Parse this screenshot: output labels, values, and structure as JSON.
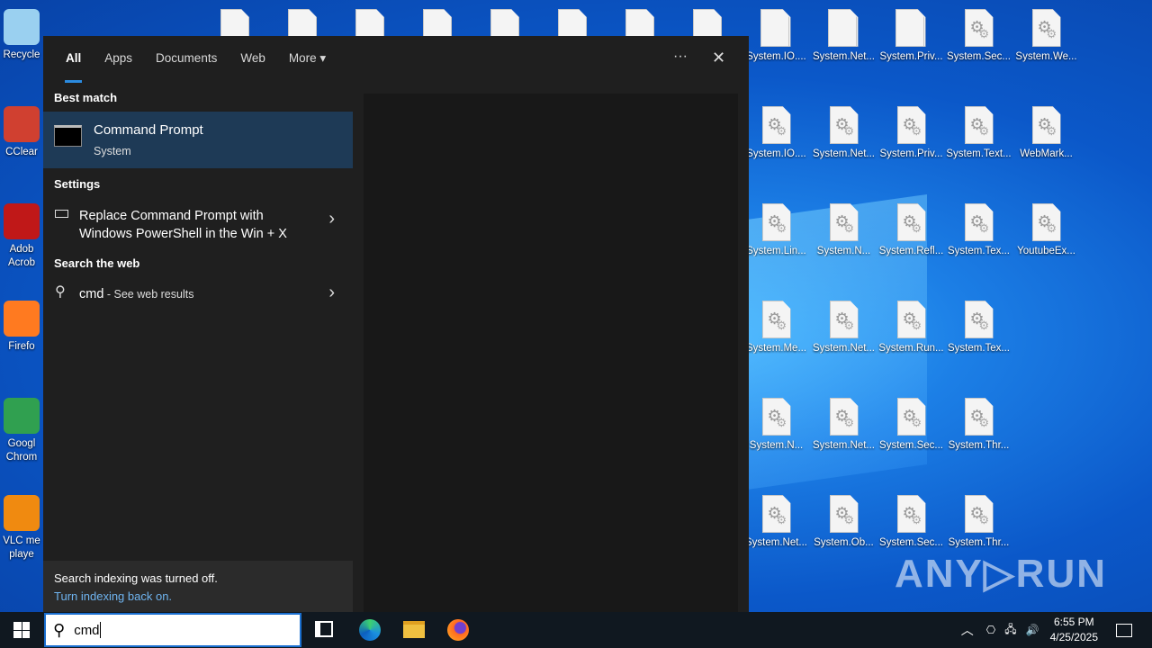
{
  "desktop": {
    "left_icons": [
      {
        "label": "Recycle",
        "color": "#9ad0f0"
      },
      {
        "label": "CClear",
        "color": "#d04030"
      },
      {
        "label": "Adob Acrob",
        "color": "#c01818"
      },
      {
        "label": "Firefo",
        "color": "#ff7a20"
      },
      {
        "label": "Googl Chrom",
        "color": "#30a050"
      },
      {
        "label": "VLC me playe",
        "color": "#f08a10"
      }
    ],
    "grid_icons": [
      [
        "System.IO....",
        "System.Net...",
        "System.Priv...",
        "System.Sec...",
        "System.We..."
      ],
      [
        "System.IO....",
        "System.Net...",
        "System.Priv...",
        "System.Text...",
        "WebMark..."
      ],
      [
        "System.Lin...",
        "System.N...",
        "System.Refl...",
        "System.Tex...",
        "YoutubeEx..."
      ],
      [
        "System.Me...",
        "System.Net...",
        "System.Run...",
        "System.Tex..."
      ],
      [
        "System.N...",
        "System.Net...",
        "System.Sec...",
        "System.Thr..."
      ],
      [
        "System.Net...",
        "System.Ob...",
        "System.Sec...",
        "System.Thr..."
      ]
    ],
    "watermark": "ANY▷RUN"
  },
  "search_panel": {
    "tabs": [
      {
        "label": "All",
        "active": true
      },
      {
        "label": "Apps"
      },
      {
        "label": "Documents"
      },
      {
        "label": "Web"
      },
      {
        "label": "More ▾"
      }
    ],
    "more_options": "···",
    "close": "✕",
    "best_match_header": "Best match",
    "best_match": {
      "title": "Command Prompt",
      "subtitle": "System"
    },
    "settings_header": "Settings",
    "settings_item": {
      "line1": "Replace Command Prompt with",
      "line2": "Windows PowerShell in the Win + X"
    },
    "web_header": "Search the web",
    "web_item": {
      "query": "cmd",
      "suffix": " - See web results"
    },
    "footer": {
      "message": "Search indexing was turned off.",
      "link": "Turn indexing back on."
    }
  },
  "taskbar": {
    "search_value": "cmd",
    "time": "6:55 PM",
    "date": "4/25/2025"
  }
}
